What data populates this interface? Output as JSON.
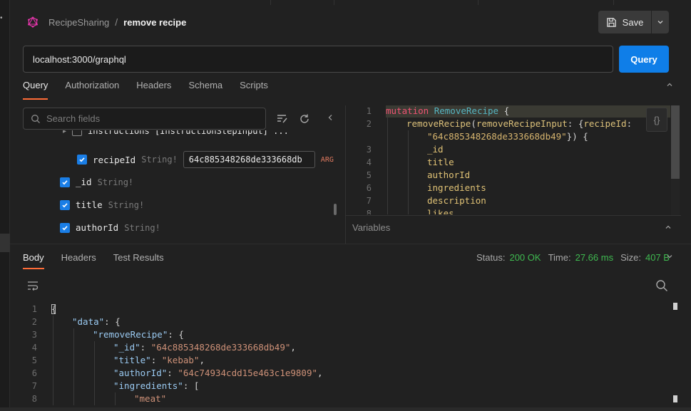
{
  "header": {
    "app_name": "RecipeSharing",
    "separator": "/",
    "request_title": "remove recipe",
    "save_label": "Save"
  },
  "url_bar": {
    "value": "localhost:3000/graphql",
    "query_button": "Query"
  },
  "request_tabs": [
    "Query",
    "Authorization",
    "Headers",
    "Schema",
    "Scripts"
  ],
  "explorer": {
    "search_placeholder": "Search fields",
    "partial_row": "instructions [InstructionStepInput] ...",
    "arg_row": {
      "name": "recipeId",
      "type": "String!",
      "value": "64c885348268de333668db",
      "badge": "ARG"
    },
    "fields": [
      {
        "name": "_id",
        "type": "String!"
      },
      {
        "name": "title",
        "type": "String!"
      },
      {
        "name": "authorId",
        "type": "String!"
      }
    ]
  },
  "query_editor": {
    "lines": [
      {
        "n": "1",
        "indent": 0,
        "parts": [
          [
            "kw",
            "mutation "
          ],
          [
            "op",
            "RemoveRecipe"
          ],
          [
            "punc",
            " {"
          ]
        ]
      },
      {
        "n": "2",
        "indent": 1,
        "parts": [
          [
            "fn",
            "removeRecipe"
          ],
          [
            "punc",
            "("
          ],
          [
            "arg",
            "removeRecipeInput"
          ],
          [
            "punc",
            ": {"
          ],
          [
            "arg",
            "recipeId"
          ],
          [
            "punc",
            ":"
          ]
        ]
      },
      {
        "n": "",
        "indent": 2,
        "parts": [
          [
            "str",
            "\"64c885348268de333668db49\""
          ],
          [
            "punc",
            "}) {"
          ]
        ]
      },
      {
        "n": "3",
        "indent": 2,
        "parts": [
          [
            "field",
            "_id"
          ]
        ]
      },
      {
        "n": "4",
        "indent": 2,
        "parts": [
          [
            "field",
            "title"
          ]
        ]
      },
      {
        "n": "5",
        "indent": 2,
        "parts": [
          [
            "field",
            "authorId"
          ]
        ]
      },
      {
        "n": "6",
        "indent": 2,
        "parts": [
          [
            "field",
            "ingredients"
          ]
        ]
      },
      {
        "n": "7",
        "indent": 2,
        "parts": [
          [
            "field",
            "description"
          ]
        ]
      },
      {
        "n": "8",
        "indent": 2,
        "parts": [
          [
            "field",
            "likes"
          ]
        ]
      }
    ]
  },
  "variables_label": "Variables",
  "response_tabs": [
    "Body",
    "Headers",
    "Test Results"
  ],
  "response_status": {
    "status_label": "Status:",
    "status_value": "200 OK",
    "time_label": "Time:",
    "time_value": "27.66 ms",
    "size_label": "Size:",
    "size_value": "407 B"
  },
  "response_body": {
    "lines": [
      {
        "n": "1",
        "indent": 0,
        "parts": [
          [
            "jp",
            "{"
          ]
        ]
      },
      {
        "n": "2",
        "indent": 1,
        "parts": [
          [
            "jkey",
            "\"data\""
          ],
          [
            "jp",
            ": {"
          ]
        ]
      },
      {
        "n": "3",
        "indent": 2,
        "parts": [
          [
            "jkey",
            "\"removeRecipe\""
          ],
          [
            "jp",
            ": {"
          ]
        ]
      },
      {
        "n": "4",
        "indent": 3,
        "parts": [
          [
            "jkey",
            "\"_id\""
          ],
          [
            "jp",
            ": "
          ],
          [
            "jstr",
            "\"64c885348268de333668db49\""
          ],
          [
            "jp",
            ","
          ]
        ]
      },
      {
        "n": "5",
        "indent": 3,
        "parts": [
          [
            "jkey",
            "\"title\""
          ],
          [
            "jp",
            ": "
          ],
          [
            "jstr",
            "\"kebab\""
          ],
          [
            "jp",
            ","
          ]
        ]
      },
      {
        "n": "6",
        "indent": 3,
        "parts": [
          [
            "jkey",
            "\"authorId\""
          ],
          [
            "jp",
            ": "
          ],
          [
            "jstr",
            "\"64c74934cdd15e463c1e9809\""
          ],
          [
            "jp",
            ","
          ]
        ]
      },
      {
        "n": "7",
        "indent": 3,
        "parts": [
          [
            "jkey",
            "\"ingredients\""
          ],
          [
            "jp",
            ": ["
          ]
        ]
      },
      {
        "n": "8",
        "indent": 4,
        "parts": [
          [
            "jstr",
            "\"meat\""
          ]
        ]
      }
    ]
  },
  "colors": {
    "accent": "#ff6c37",
    "primary_button": "#0f7ee8",
    "success": "#3fb950"
  }
}
